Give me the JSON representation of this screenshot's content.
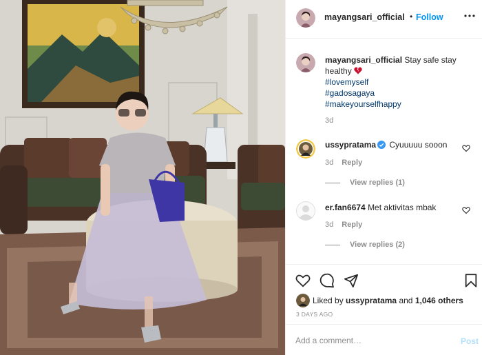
{
  "post": {
    "photo_description": "",
    "author": {
      "username": "mayangsari_official",
      "separator": "•",
      "follow_label": "Follow"
    },
    "caption": {
      "username": "mayangsari_official",
      "text": "Stay safe stay healthy",
      "emoji": "broken-heart",
      "hashtags": [
        "#lovemyself",
        "#gadosagaya",
        "#makeyourselfhappy"
      ],
      "time": "3d"
    },
    "comments": [
      {
        "username": "ussypratama",
        "verified": true,
        "text": "Cyuuuuu sooon",
        "time": "3d",
        "reply_label": "Reply",
        "view_replies": "View replies (1)"
      },
      {
        "username": "er.fan6674",
        "verified": false,
        "text": "Met aktivitas mbak",
        "time": "3d",
        "reply_label": "Reply",
        "view_replies": "View replies (2)"
      }
    ],
    "likes": {
      "prefix": "Liked by",
      "user": "ussypratama",
      "joiner": "and",
      "others": "1,046 others"
    },
    "timestamp": "3 DAYS AGO",
    "add_comment": {
      "placeholder": "Add a comment…",
      "post_label": "Post"
    },
    "icons": {
      "more": "more-options-icon",
      "like": "heart-icon",
      "comment": "comment-icon",
      "share": "share-icon",
      "save": "bookmark-icon",
      "verified": "verified-badge-icon"
    },
    "colors": {
      "link": "#0095f6",
      "hashtag": "#00376b",
      "secondary_text": "#8e8e8e",
      "post_disabled": "#b2dffc",
      "verified": "#3897f0"
    }
  }
}
